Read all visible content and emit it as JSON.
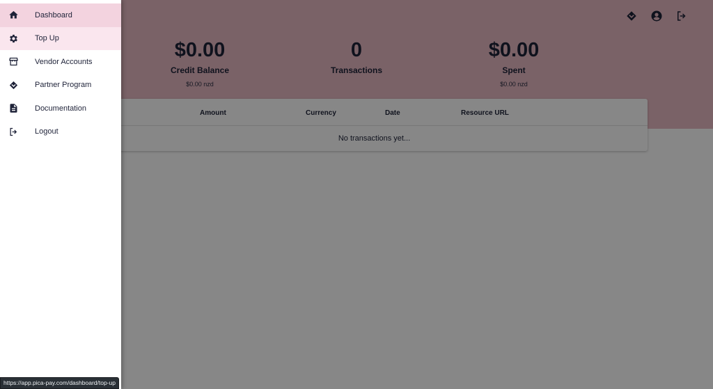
{
  "header": {
    "icons": [
      "partner-icon",
      "account-circle-icon",
      "logout-icon"
    ]
  },
  "stats": [
    {
      "value": "$0.00",
      "label": "Credit Balance",
      "sub": "$0.00 nzd"
    },
    {
      "value": "0",
      "label": "Transactions",
      "sub": ""
    },
    {
      "value": "$0.00",
      "label": "Spent",
      "sub": "$0.00 nzd"
    }
  ],
  "table": {
    "headers": [
      "Amount",
      "Currency",
      "Date",
      "Resource URL"
    ],
    "empty_text": "No transactions yet..."
  },
  "drawer": {
    "items": [
      {
        "label": "Dashboard",
        "icon": "home-icon"
      },
      {
        "label": "Top Up",
        "icon": "gear-icon"
      },
      {
        "label": "Vendor Accounts",
        "icon": "store-icon"
      },
      {
        "label": "Partner Program",
        "icon": "partner-icon"
      },
      {
        "label": "Documentation",
        "icon": "document-icon"
      },
      {
        "label": "Logout",
        "icon": "logout-icon"
      }
    ]
  },
  "status_bar": {
    "url": "https://app.pica-pay.com/dashboard/top-up"
  },
  "colors": {
    "hero": "#e7bac3",
    "text": "#1e2238",
    "active_item": "#f3d3df",
    "hover_item": "#fae6ee"
  }
}
